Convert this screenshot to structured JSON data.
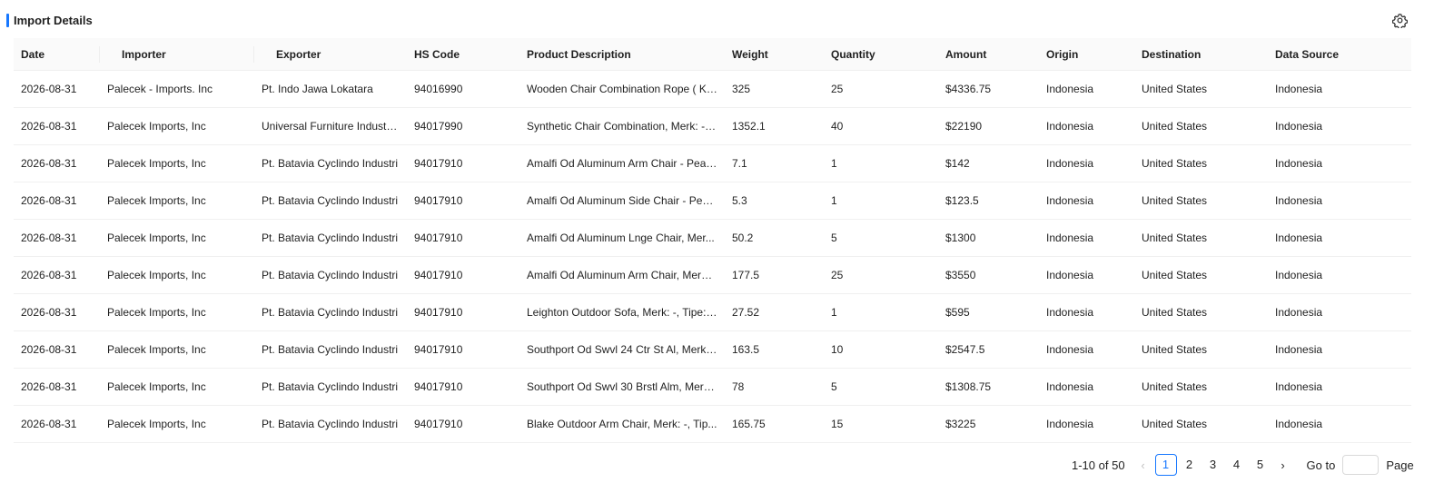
{
  "section": {
    "title": "Import Details"
  },
  "icons": {
    "settings": "gear-icon"
  },
  "table": {
    "columns": [
      "Date",
      "Importer",
      "Exporter",
      "HS Code",
      "Product Description",
      "Weight",
      "Quantity",
      "Amount",
      "Origin",
      "Destination",
      "Data Source"
    ],
    "rows": [
      [
        "2026-08-31",
        "Palecek - Imports. Inc",
        "Pt. Indo Jawa Lokatara",
        "94016990",
        "Wooden Chair Combination Rope ( Ku...",
        "325",
        "25",
        "$4336.75",
        "Indonesia",
        "United States",
        "Indonesia"
      ],
      [
        "2026-08-31",
        "Palecek Imports, Inc",
        "Universal Furniture Industri...",
        "94017990",
        "Synthetic Chair Combination, Merk: -, ...",
        "1352.1",
        "40",
        "$22190",
        "Indonesia",
        "United States",
        "Indonesia"
      ],
      [
        "2026-08-31",
        "Palecek Imports, Inc",
        "Pt. Batavia Cyclindo Industri",
        "94017910",
        "Amalfi Od Aluminum Arm Chair - Pear...",
        "7.1",
        "1",
        "$142",
        "Indonesia",
        "United States",
        "Indonesia"
      ],
      [
        "2026-08-31",
        "Palecek Imports, Inc",
        "Pt. Batavia Cyclindo Industri",
        "94017910",
        "Amalfi Od Aluminum Side Chair - Pear...",
        "5.3",
        "1",
        "$123.5",
        "Indonesia",
        "United States",
        "Indonesia"
      ],
      [
        "2026-08-31",
        "Palecek Imports, Inc",
        "Pt. Batavia Cyclindo Industri",
        "94017910",
        "Amalfi Od Aluminum Lnge Chair, Mer...",
        "50.2",
        "5",
        "$1300",
        "Indonesia",
        "United States",
        "Indonesia"
      ],
      [
        "2026-08-31",
        "Palecek Imports, Inc",
        "Pt. Batavia Cyclindo Industri",
        "94017910",
        "Amalfi Od Aluminum Arm Chair, Merk:...",
        "177.5",
        "25",
        "$3550",
        "Indonesia",
        "United States",
        "Indonesia"
      ],
      [
        "2026-08-31",
        "Palecek Imports, Inc",
        "Pt. Batavia Cyclindo Industri",
        "94017910",
        "Leighton Outdoor Sofa, Merk: -, Tipe: ...",
        "27.52",
        "1",
        "$595",
        "Indonesia",
        "United States",
        "Indonesia"
      ],
      [
        "2026-08-31",
        "Palecek Imports, Inc",
        "Pt. Batavia Cyclindo Industri",
        "94017910",
        "Southport Od Swvl 24 Ctr St Al, Merk: ...",
        "163.5",
        "10",
        "$2547.5",
        "Indonesia",
        "United States",
        "Indonesia"
      ],
      [
        "2026-08-31",
        "Palecek Imports, Inc",
        "Pt. Batavia Cyclindo Industri",
        "94017910",
        "Southport Od Swvl 30 Brstl Alm, Merk:...",
        "78",
        "5",
        "$1308.75",
        "Indonesia",
        "United States",
        "Indonesia"
      ],
      [
        "2026-08-31",
        "Palecek Imports, Inc",
        "Pt. Batavia Cyclindo Industri",
        "94017910",
        "Blake Outdoor Arm Chair, Merk: -, Tip...",
        "165.75",
        "15",
        "$3225",
        "Indonesia",
        "United States",
        "Indonesia"
      ]
    ]
  },
  "pagination": {
    "total_text": "1-10 of 50",
    "pages": [
      "1",
      "2",
      "3",
      "4",
      "5"
    ],
    "current": "1",
    "prev_glyph": "‹",
    "next_glyph": "›",
    "goto_label": "Go to",
    "goto_value": "",
    "page_label": "Page"
  },
  "colors": {
    "accent": "#1677ff",
    "header_bg": "#fafafa",
    "border": "#f0f0f0"
  }
}
